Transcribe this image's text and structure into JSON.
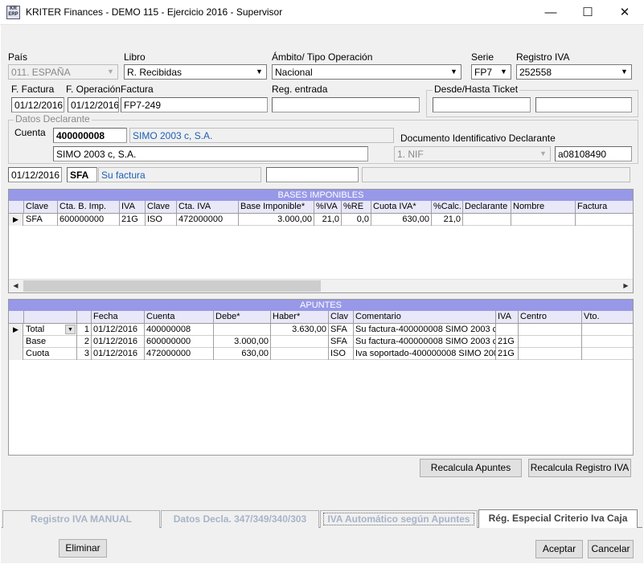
{
  "window": {
    "title": "KRITER Finances - DEMO 115 - Ejercicio 2016 - Supervisor",
    "icon_text": "KR ERP",
    "minimize": "—",
    "maximize": "☐",
    "close": "✕"
  },
  "form": {
    "pais_label": "País",
    "pais_value": "011. ESPAÑA",
    "libro_label": "Libro",
    "libro_value": "R. Recibidas",
    "ambito_label": "Ámbito/ Tipo Operación",
    "ambito_value": "Nacional",
    "serie_label": "Serie",
    "serie_value": "FP7",
    "registro_label": "Registro IVA",
    "registro_value": "252558",
    "ffactura_label": "F. Factura",
    "ffactura_value": "01/12/2016",
    "foperacion_label": "F. Operación",
    "foperacion_value": "01/12/2016",
    "factura_label": "Factura",
    "factura_value": "FP7-249",
    "regentrada_label": "Reg. entrada",
    "regentrada_value": "",
    "ticket_label": "Desde/Hasta Ticket",
    "ticket_desde": "",
    "ticket_hasta": "",
    "datos_declarante_label": "Datos Declarante",
    "cuenta_label": "Cuenta",
    "cuenta_value": "400000008",
    "cuenta_desc": "SIMO 2003 c, S.A.",
    "declarante_nombre": "SIMO 2003 c, S.A.",
    "doc_ident_label": "Documento Identificativo Declarante",
    "doc_tipo": "1. NIF",
    "doc_numero": "a08108490",
    "summary_fecha": "01/12/2016",
    "summary_clave": "SFA",
    "summary_desc": "Su factura",
    "summary_extra1": "",
    "summary_extra2": ""
  },
  "bases": {
    "title": "BASES IMPONIBLES",
    "columns": [
      "Clave",
      "Cta. B. Imp.",
      "IVA",
      "Clave",
      "Cta. IVA",
      "Base Imponible*",
      "%IVA",
      "%RE",
      "Cuota IVA*",
      "%Calc.",
      "Declarante",
      "Nombre",
      "Factura"
    ],
    "rows": [
      {
        "clave": "SFA",
        "cta_base": "600000000",
        "iva": "21G",
        "clave2": "ISO",
        "cta_iva": "472000000",
        "base": "3.000,00",
        "pct_iva": "21,0",
        "pct_re": "0,0",
        "cuota": "630,00",
        "pct_calc": "21,0",
        "declarante": "",
        "nombre": "",
        "factura": ""
      }
    ]
  },
  "apuntes": {
    "title": "APUNTES",
    "columns": [
      "",
      "",
      "Fecha",
      "Cuenta",
      "Debe*",
      "Haber*",
      "Clav",
      "Comentario",
      "IVA",
      "Centro",
      "Vto."
    ],
    "rows": [
      {
        "tipo": "Total",
        "n": "1",
        "fecha": "01/12/2016",
        "cuenta": "400000008",
        "debe": "",
        "haber": "3.630,00",
        "clav": "SFA",
        "comentario": "Su factura-400000008 SIMO 2003 c",
        "iva": "",
        "centro": "",
        "vto": ""
      },
      {
        "tipo": "Base",
        "n": "2",
        "fecha": "01/12/2016",
        "cuenta": "600000000",
        "debe": "3.000,00",
        "haber": "",
        "clav": "SFA",
        "comentario": "Su factura-400000008 SIMO 2003 c",
        "iva": "21G",
        "centro": "",
        "vto": ""
      },
      {
        "tipo": "Cuota",
        "n": "3",
        "fecha": "01/12/2016",
        "cuenta": "472000000",
        "debe": "630,00",
        "haber": "",
        "clav": "ISO",
        "comentario": "Iva soportado-400000008 SIMO 200",
        "iva": "21G",
        "centro": "",
        "vto": ""
      }
    ]
  },
  "buttons": {
    "recalcula_apuntes": "Recalcula Apuntes",
    "recalcula_registro": "Recalcula Registro IVA",
    "eliminar": "Eliminar",
    "aceptar": "Aceptar",
    "cancelar": "Cancelar"
  },
  "tabs": [
    {
      "label": "Registro IVA MANUAL",
      "active": false
    },
    {
      "label": "Datos Decla. 347/349/340/303",
      "active": false
    },
    {
      "label": "IVA Automático según Apuntes",
      "active": false
    },
    {
      "label": "Rég. Especial Criterio Iva Caja",
      "active": true
    }
  ],
  "icons": {
    "dropdown": "▼",
    "row_pointer": "▶",
    "scroll_left": "◀",
    "scroll_right": "▶"
  },
  "colors": {
    "grid_title": "#9898e8",
    "link_text": "#1c5fb5"
  }
}
